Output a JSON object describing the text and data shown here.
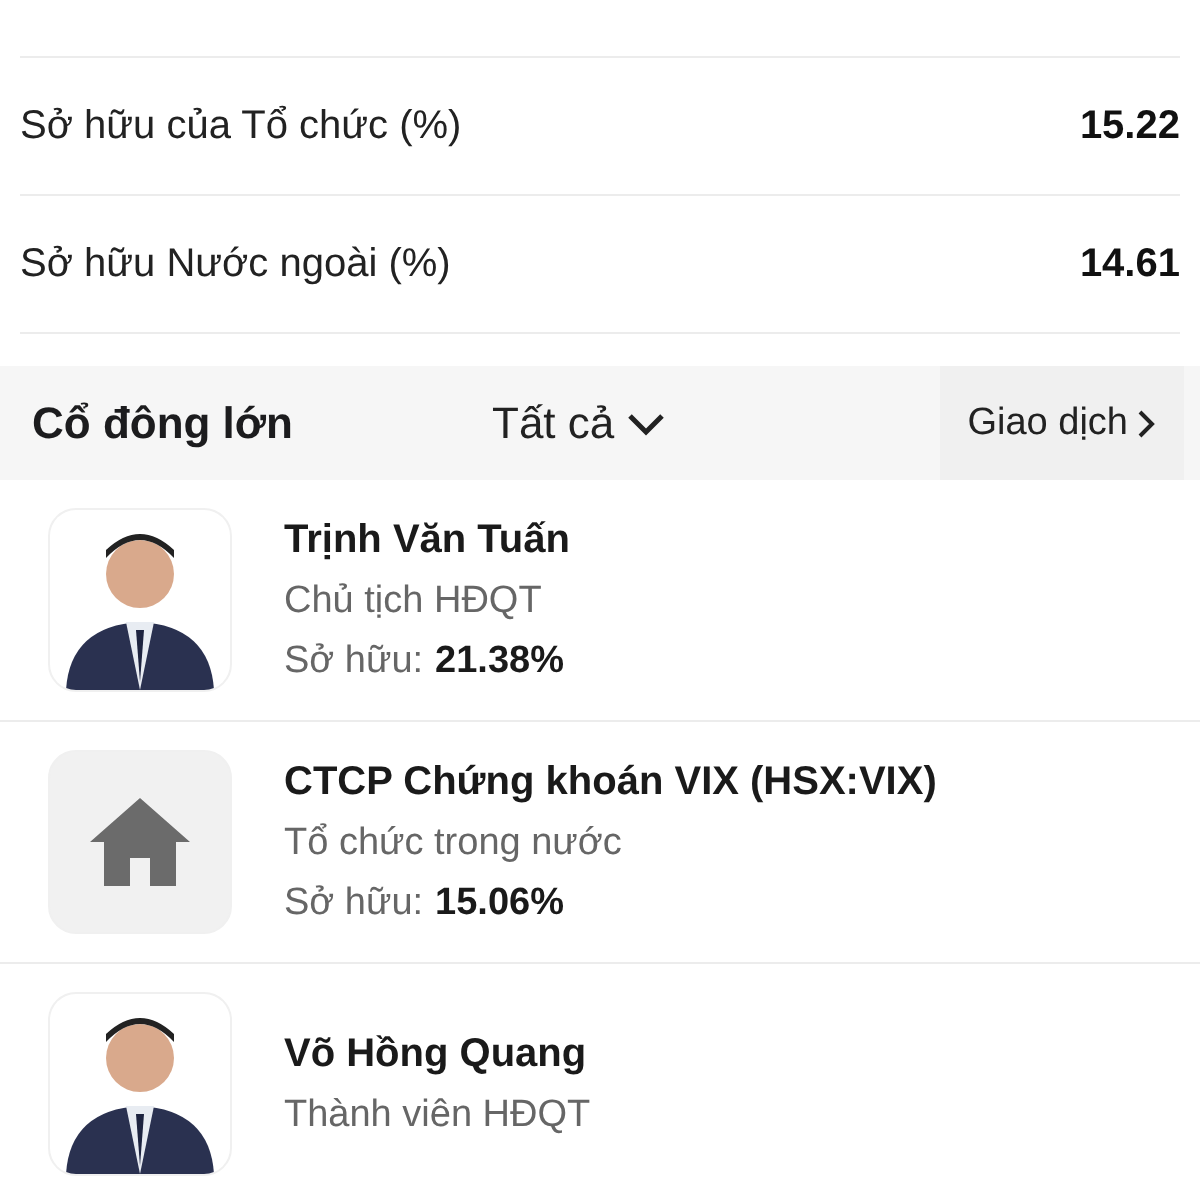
{
  "ownership_rows": [
    {
      "label": "Sở hữu của Tổ chức (%)",
      "value": "15.22"
    },
    {
      "label": "Sở hữu Nước ngoài (%)",
      "value": "14.61"
    }
  ],
  "shareholders_header": {
    "title": "Cổ đông lớn",
    "filter": "Tất cả",
    "trades_button": "Giao dịch"
  },
  "shareholders": [
    {
      "kind": "person",
      "name": "Trịnh Văn Tuấn",
      "role": "Chủ tịch HĐQT",
      "ownership_label": "Sở hữu:",
      "ownership": "21.38%"
    },
    {
      "kind": "organization",
      "name": "CTCP Chứng khoán VIX (HSX:VIX)",
      "role": "Tổ chức trong nước",
      "ownership_label": "Sở hữu:",
      "ownership": "15.06%"
    },
    {
      "kind": "person",
      "name": "Võ Hồng Quang",
      "role": "Thành viên HĐQT"
    }
  ]
}
